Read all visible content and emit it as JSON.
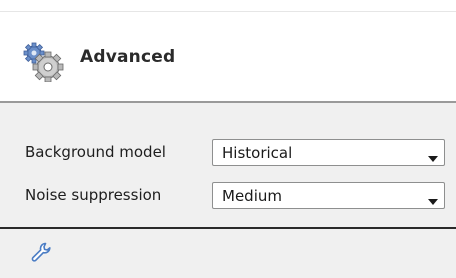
{
  "header": {
    "title": "Advanced",
    "icon": "gear-icon"
  },
  "settings": {
    "background_model": {
      "label": "Background model",
      "value": "Historical"
    },
    "noise_suppression": {
      "label": "Noise suppression",
      "value": "Medium"
    }
  },
  "footer": {
    "icon": "wrench-icon"
  },
  "colors": {
    "panel_bg": "#f0f0f0",
    "header_bg": "#ffffff",
    "divider": "#2a2a2a"
  }
}
